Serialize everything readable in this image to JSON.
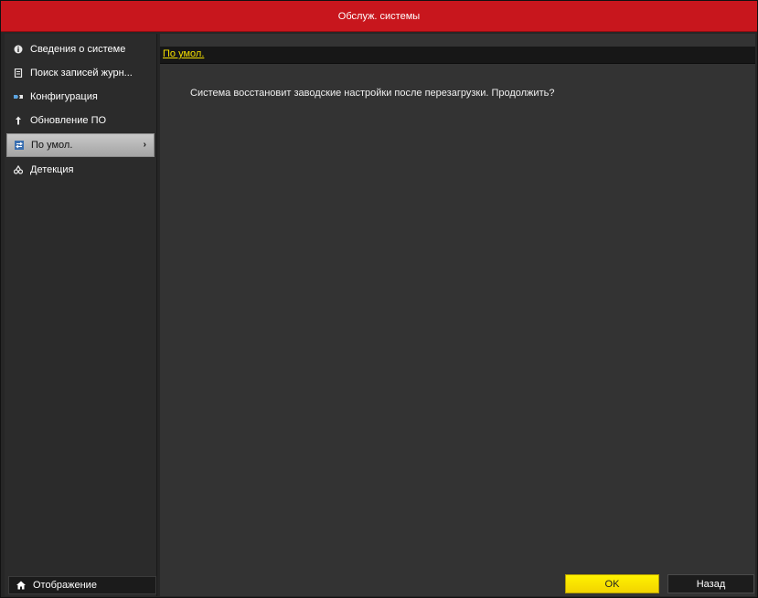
{
  "window": {
    "title": "Обслуж. системы"
  },
  "sidebar": {
    "items": [
      {
        "label": "Сведения о системе",
        "icon": "info-icon",
        "active": false
      },
      {
        "label": "Поиск записей журн...",
        "icon": "log-icon",
        "active": false
      },
      {
        "label": "Конфигурация",
        "icon": "config-icon",
        "active": false
      },
      {
        "label": "Обновление ПО",
        "icon": "upgrade-icon",
        "active": false
      },
      {
        "label": "По умол.",
        "icon": "default-icon",
        "active": true
      },
      {
        "label": "Детекция",
        "icon": "detection-icon",
        "active": false
      }
    ],
    "home_label": "Отображение"
  },
  "content": {
    "tab_label": "По умол.",
    "message": "Система восстановит заводские настройки после перезагрузки. Продолжить?"
  },
  "buttons": {
    "ok": "OK",
    "back": "Назад"
  },
  "colors": {
    "title_bar": "#c8161d",
    "tab_accent": "#f5e000",
    "ok_button": "#fff200",
    "active_item": "#b8b8b8"
  }
}
